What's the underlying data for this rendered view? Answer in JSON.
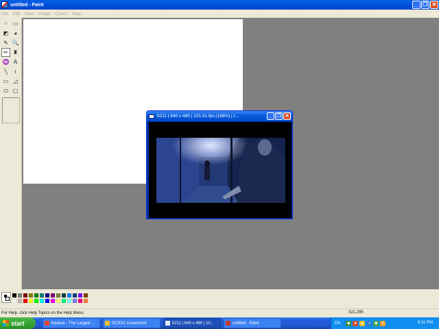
{
  "paint": {
    "title": "untitled - Paint",
    "menu": [
      "File",
      "Edit",
      "View",
      "Image",
      "Colors",
      "Help"
    ],
    "tools": [
      {
        "name": "free-form-select-icon",
        "glyph": "⁘"
      },
      {
        "name": "select-icon",
        "glyph": "▭"
      },
      {
        "name": "eraser-icon",
        "glyph": "◩"
      },
      {
        "name": "fill-icon",
        "glyph": "◕"
      },
      {
        "name": "pick-color-icon",
        "glyph": "✎"
      },
      {
        "name": "magnifier-icon",
        "glyph": "🔍"
      },
      {
        "name": "pencil-icon",
        "glyph": "✏"
      },
      {
        "name": "brush-icon",
        "glyph": "♜"
      },
      {
        "name": "airbrush-icon",
        "glyph": "♒"
      },
      {
        "name": "text-icon",
        "glyph": "A"
      },
      {
        "name": "line-icon",
        "glyph": "╲"
      },
      {
        "name": "curve-icon",
        "glyph": "≀"
      },
      {
        "name": "rectangle-icon",
        "glyph": "▭"
      },
      {
        "name": "polygon-icon",
        "glyph": "◿"
      },
      {
        "name": "ellipse-icon",
        "glyph": "⬭"
      },
      {
        "name": "rounded-rectangle-icon",
        "glyph": "▢"
      }
    ],
    "selected_tool": 6,
    "palette_top": [
      "#000000",
      "#808080",
      "#800000",
      "#808000",
      "#008000",
      "#008080",
      "#000080",
      "#800080",
      "#808040",
      "#004040",
      "#0080ff",
      "#004080",
      "#8000ff",
      "#804000"
    ],
    "palette_bottom": [
      "#ffffff",
      "#c0c0c0",
      "#ff0000",
      "#ffff00",
      "#00ff00",
      "#00ffff",
      "#0000ff",
      "#ff00ff",
      "#ffff80",
      "#00ff80",
      "#80ffff",
      "#8080ff",
      "#ff0080",
      "#ff8040"
    ],
    "status_help": "For Help, click Help Topics on the Help Menu.",
    "status_coords": "321,295"
  },
  "emulator": {
    "title": "5211 | 640 x 480 | 101.01 fps (168%) | I..."
  },
  "taskbar": {
    "start_label": "start",
    "buttons": [
      {
        "label": "Kaskus - The Largest ...",
        "active": false,
        "icon_color": "#e8452c"
      },
      {
        "label": "PCSX2 screenshot",
        "active": false,
        "icon_color": "#f0c030"
      },
      {
        "label": "5211 | 640 x 480 | 10...",
        "active": true,
        "icon_color": "#dfe8f8"
      },
      {
        "label": "untitled - Paint",
        "active": false,
        "icon_color": "#c0392b"
      }
    ],
    "language": "EN",
    "time": "6:11 PM"
  }
}
